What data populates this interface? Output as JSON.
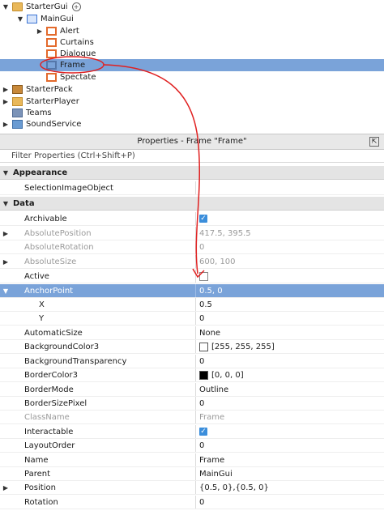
{
  "explorer": {
    "items": [
      {
        "label": "StarterGui",
        "icon": "folder-icon",
        "expand": "▼",
        "extra_icon": "plus-icon"
      },
      {
        "label": "MainGui",
        "icon": "screen-gui-icon",
        "expand": "▼"
      },
      {
        "label": "Alert",
        "icon": "frame-icon",
        "expand": "▶"
      },
      {
        "label": "Curtains",
        "icon": "frame-icon",
        "expand": ""
      },
      {
        "label": "Dialogue",
        "icon": "frame-icon",
        "expand": ""
      },
      {
        "label": "Frame",
        "icon": "frame-icon",
        "expand": "",
        "selected": true
      },
      {
        "label": "Spectate",
        "icon": "frame-icon",
        "expand": ""
      },
      {
        "label": "StarterPack",
        "icon": "starterpack-icon",
        "expand": "▶"
      },
      {
        "label": "StarterPlayer",
        "icon": "starterplayer-icon",
        "expand": "▶"
      },
      {
        "label": "Teams",
        "icon": "teams-icon",
        "expand": ""
      },
      {
        "label": "SoundService",
        "icon": "soundservice-icon",
        "expand": "▶"
      }
    ]
  },
  "properties": {
    "header": "Properties - Frame \"Frame\"",
    "filter_placeholder": "Filter Properties (Ctrl+Shift+P)",
    "categories": {
      "appearance": "Appearance",
      "data": "Data"
    },
    "rows": {
      "selection_image_object": {
        "name": "SelectionImageObject",
        "value": ""
      },
      "archivable": {
        "name": "Archivable",
        "value": "checked"
      },
      "absolute_position": {
        "name": "AbsolutePosition",
        "value": "417.5, 395.5"
      },
      "absolute_rotation": {
        "name": "AbsoluteRotation",
        "value": "0"
      },
      "absolute_size": {
        "name": "AbsoluteSize",
        "value": "600, 100"
      },
      "active": {
        "name": "Active",
        "value": "unchecked"
      },
      "anchor_point": {
        "name": "AnchorPoint",
        "value": "0.5, 0"
      },
      "x": {
        "name": "X",
        "value": "0.5"
      },
      "y": {
        "name": "Y",
        "value": "0"
      },
      "automatic_size": {
        "name": "AutomaticSize",
        "value": "None"
      },
      "background_color3": {
        "name": "BackgroundColor3",
        "value": "[255, 255, 255]",
        "swatch": "#ffffff"
      },
      "background_transparency": {
        "name": "BackgroundTransparency",
        "value": "0"
      },
      "border_color3": {
        "name": "BorderColor3",
        "value": "[0, 0, 0]",
        "swatch": "#000000"
      },
      "border_mode": {
        "name": "BorderMode",
        "value": "Outline"
      },
      "border_size_pixel": {
        "name": "BorderSizePixel",
        "value": "0"
      },
      "class_name": {
        "name": "ClassName",
        "value": "Frame"
      },
      "interactable": {
        "name": "Interactable",
        "value": "checked"
      },
      "layout_order": {
        "name": "LayoutOrder",
        "value": "0"
      },
      "name": {
        "name": "Name",
        "value": "Frame"
      },
      "parent": {
        "name": "Parent",
        "value": "MainGui"
      },
      "position": {
        "name": "Position",
        "value": "{0.5, 0},{0.5, 0}"
      },
      "rotation": {
        "name": "Rotation",
        "value": "0"
      }
    }
  },
  "colors": {
    "selection": "#7aa3d9",
    "annotation": "#e02020",
    "checkbox": "#3b8edb"
  }
}
